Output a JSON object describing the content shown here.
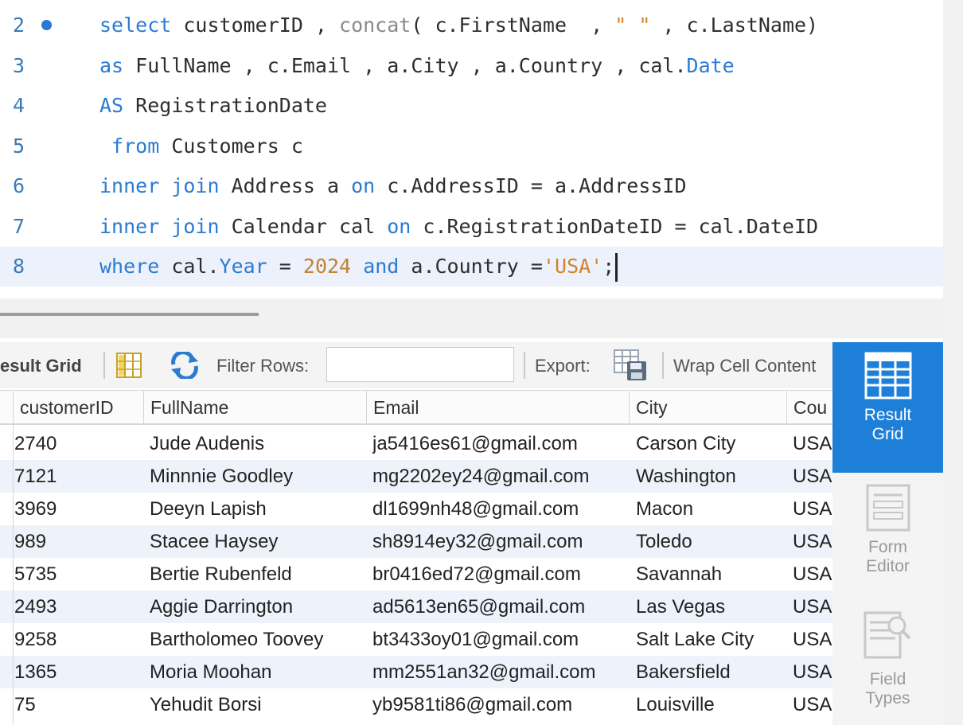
{
  "editor": {
    "lines": [
      {
        "num": "2",
        "marker": true,
        "tokens": [
          {
            "t": "kw",
            "v": "select"
          },
          {
            "t": "id",
            "v": " customerID , "
          },
          {
            "t": "fn",
            "v": "concat"
          },
          {
            "t": "id",
            "v": "( c.FirstName  , "
          },
          {
            "t": "str",
            "v": "\" \""
          },
          {
            "t": "id",
            "v": " , c.LastName)"
          }
        ]
      },
      {
        "num": "3",
        "marker": false,
        "tokens": [
          {
            "t": "kw",
            "v": "as"
          },
          {
            "t": "id",
            "v": " FullName , c.Email , a.City , a.Country , cal."
          },
          {
            "t": "kw",
            "v": "Date"
          }
        ]
      },
      {
        "num": "4",
        "marker": false,
        "tokens": [
          {
            "t": "kw",
            "v": "AS"
          },
          {
            "t": "id",
            "v": " RegistrationDate"
          }
        ]
      },
      {
        "num": "5",
        "marker": false,
        "tokens": [
          {
            "t": "kw",
            "v": " from"
          },
          {
            "t": "id",
            "v": " Customers c"
          }
        ]
      },
      {
        "num": "6",
        "marker": false,
        "tokens": [
          {
            "t": "kw",
            "v": "inner join"
          },
          {
            "t": "id",
            "v": " Address a "
          },
          {
            "t": "kw",
            "v": "on"
          },
          {
            "t": "id",
            "v": " c.AddressID = a.AddressID"
          }
        ]
      },
      {
        "num": "7",
        "marker": false,
        "tokens": [
          {
            "t": "kw",
            "v": "inner join"
          },
          {
            "t": "id",
            "v": " Calendar cal "
          },
          {
            "t": "kw",
            "v": "on"
          },
          {
            "t": "id",
            "v": " c.RegistrationDateID = cal.DateID"
          }
        ]
      },
      {
        "num": "8",
        "marker": false,
        "active": true,
        "caret": true,
        "tokens": [
          {
            "t": "kw",
            "v": "where"
          },
          {
            "t": "id",
            "v": " cal."
          },
          {
            "t": "kw",
            "v": "Year"
          },
          {
            "t": "id",
            "v": " = "
          },
          {
            "t": "num",
            "v": "2024"
          },
          {
            "t": "id",
            "v": " "
          },
          {
            "t": "kw",
            "v": "and"
          },
          {
            "t": "id",
            "v": " a.Country ="
          },
          {
            "t": "str",
            "v": "'USA'"
          },
          {
            "t": "id",
            "v": ";"
          }
        ]
      }
    ]
  },
  "toolbar": {
    "result_grid_label": "esult Grid",
    "filter_rows_label": "Filter Rows:",
    "filter_value": "",
    "export_label": "Export:",
    "wrap_label": "Wrap Cell Content"
  },
  "grid": {
    "columns": [
      "customerID",
      "FullName",
      "Email",
      "City",
      "Cou"
    ],
    "rows": [
      [
        "2740",
        "Jude Audenis",
        "ja5416es61@gmail.com",
        "Carson City",
        "USA"
      ],
      [
        "7121",
        "Minnnie Goodley",
        "mg2202ey24@gmail.com",
        "Washington",
        "USA"
      ],
      [
        "3969",
        "Deeyn Lapish",
        "dl1699nh48@gmail.com",
        "Macon",
        "USA"
      ],
      [
        "989",
        "Stacee Haysey",
        "sh8914ey32@gmail.com",
        "Toledo",
        "USA"
      ],
      [
        "5735",
        "Bertie Rubenfeld",
        "br0416ed72@gmail.com",
        "Savannah",
        "USA"
      ],
      [
        "2493",
        "Aggie Darrington",
        "ad5613en65@gmail.com",
        "Las Vegas",
        "USA"
      ],
      [
        "9258",
        "Bartholomeo Toovey",
        "bt3433oy01@gmail.com",
        "Salt Lake City",
        "USA"
      ],
      [
        "1365",
        "Moria Moohan",
        "mm2551an32@gmail.com",
        "Bakersfield",
        "USA"
      ],
      [
        "75",
        "Yehudit Borsi",
        "yb9581ti86@gmail.com",
        "Louisville",
        "USA"
      ]
    ]
  },
  "side_panel": {
    "result_grid": [
      "Result",
      "Grid"
    ],
    "form_editor": [
      "Form",
      "Editor"
    ],
    "field_types": [
      "Field",
      "Types"
    ]
  },
  "colors": {
    "keyword": "#2b7bd1",
    "string": "#d3832c",
    "accent": "#1e7fd8",
    "row_alt": "#eef3fb"
  }
}
